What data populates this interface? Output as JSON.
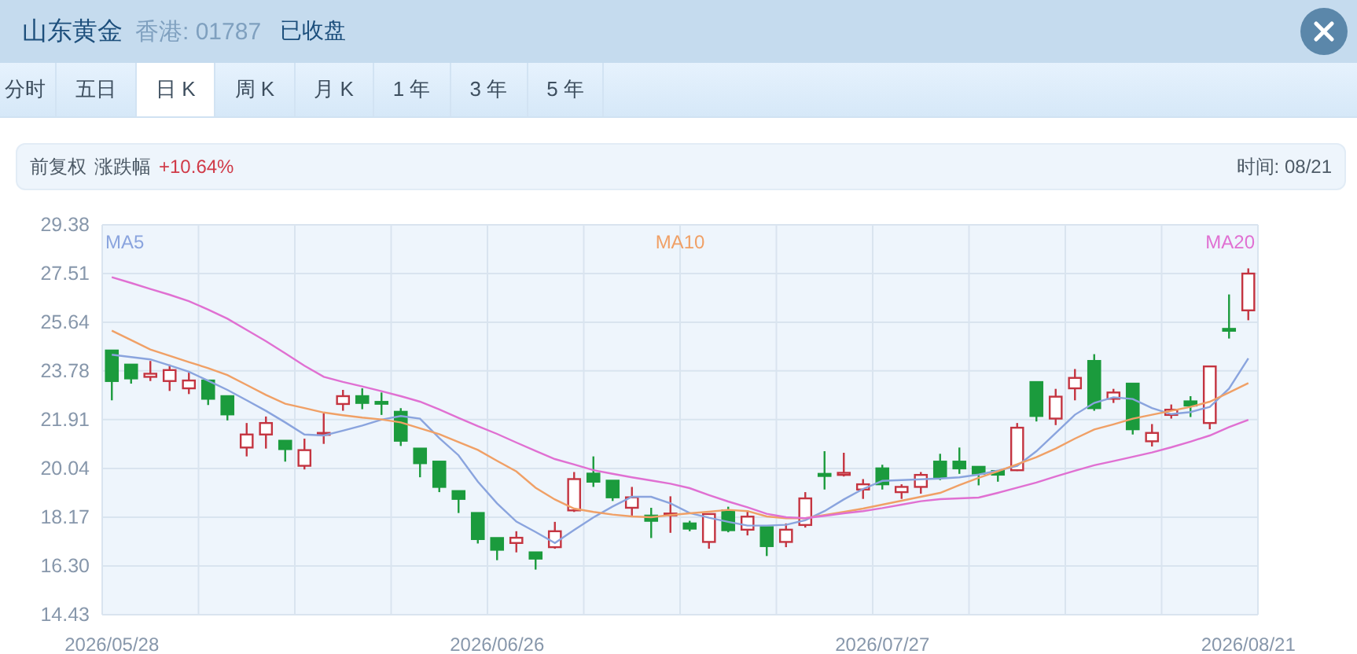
{
  "header": {
    "name": "山东黄金",
    "market": "香港: 01787",
    "status": "已收盘"
  },
  "tabs": [
    {
      "label": "分时",
      "selected": false
    },
    {
      "label": "五日",
      "selected": false
    },
    {
      "label": "日 K",
      "selected": true
    },
    {
      "label": "周 K",
      "selected": false
    },
    {
      "label": "月 K",
      "selected": false
    },
    {
      "label": "1 年",
      "selected": false
    },
    {
      "label": "3 年",
      "selected": false
    },
    {
      "label": "5 年",
      "selected": false
    }
  ],
  "info_bar": {
    "adjust": "前复权",
    "change_label": "涨跌幅",
    "change": "+10.64%",
    "time": "时间: 08/21"
  },
  "chart": {
    "chart_data": {
      "type": "candlestick",
      "grid": true,
      "categories": [
        "2026/05/28",
        null,
        null,
        null,
        null,
        null,
        null,
        null,
        null,
        null,
        null,
        null,
        null,
        null,
        null,
        null,
        null,
        null,
        null,
        null,
        "2026/06/26",
        null,
        null,
        null,
        null,
        null,
        null,
        null,
        null,
        null,
        null,
        null,
        null,
        null,
        null,
        null,
        null,
        null,
        null,
        null,
        "2026/07/27",
        null,
        null,
        null,
        null,
        null,
        null,
        null,
        null,
        null,
        null,
        null,
        null,
        null,
        null,
        null,
        null,
        null,
        null,
        "2026/08/21"
      ],
      "ylim": [
        14.43,
        29.38
      ],
      "yticks": [
        14.43,
        {
          "value": 16.3,
          "label": "16.30"
        },
        18.17,
        20.04,
        21.91,
        23.78,
        25.64,
        27.51,
        29.38
      ],
      "series": [
        {
          "name": "MA5",
          "type": "line",
          "color": "#8aa4de",
          "values": [
            24.4,
            24.31,
            24.22,
            23.99,
            23.75,
            23.4,
            23.05,
            22.65,
            22.25,
            21.8,
            21.34,
            21.3,
            21.49,
            21.68,
            21.91,
            22.05,
            21.95,
            21.2,
            20.54,
            19.53,
            18.7,
            18.0,
            17.6,
            17.18,
            17.68,
            18.16,
            18.58,
            18.95,
            18.95,
            18.7,
            18.33,
            18.15,
            17.99,
            17.85,
            17.85,
            17.88,
            18.05,
            18.4,
            18.85,
            19.25,
            19.56,
            19.59,
            19.62,
            19.65,
            19.7,
            19.8,
            19.95,
            20.14,
            20.7,
            21.4,
            22.1,
            22.55,
            22.77,
            22.7,
            22.35,
            22.12,
            22.2,
            22.4,
            23.1,
            24.26
          ]
        },
        {
          "name": "MA10",
          "type": "line",
          "color": "#f0a066",
          "values": [
            25.32,
            24.96,
            24.6,
            24.36,
            24.12,
            23.88,
            23.62,
            23.24,
            22.86,
            22.52,
            22.35,
            22.18,
            22.08,
            21.99,
            21.92,
            21.8,
            21.58,
            21.35,
            21.05,
            20.75,
            20.33,
            19.92,
            19.3,
            18.85,
            18.5,
            18.37,
            18.27,
            18.2,
            18.17,
            18.25,
            18.32,
            18.38,
            18.45,
            18.4,
            18.2,
            18.13,
            18.13,
            18.25,
            18.37,
            18.5,
            18.65,
            18.8,
            18.95,
            19.1,
            19.4,
            19.68,
            19.93,
            20.2,
            20.47,
            20.8,
            21.18,
            21.53,
            21.73,
            21.95,
            22.1,
            22.25,
            22.4,
            22.6,
            22.95,
            23.31
          ]
        },
        {
          "name": "MA20",
          "type": "line",
          "color": "#e070d2",
          "values": [
            27.37,
            27.15,
            26.92,
            26.7,
            26.45,
            26.13,
            25.78,
            25.35,
            24.92,
            24.45,
            23.98,
            23.55,
            23.36,
            23.18,
            23.0,
            22.81,
            22.6,
            22.3,
            21.98,
            21.66,
            21.36,
            21.03,
            20.71,
            20.4,
            20.19,
            19.97,
            19.83,
            19.7,
            19.58,
            19.45,
            19.28,
            19.02,
            18.77,
            18.55,
            18.3,
            18.17,
            18.13,
            18.22,
            18.32,
            18.4,
            18.52,
            18.65,
            18.78,
            18.86,
            18.89,
            18.92,
            19.1,
            19.3,
            19.5,
            19.73,
            19.95,
            20.16,
            20.32,
            20.48,
            20.65,
            20.85,
            21.07,
            21.3,
            21.62,
            21.9
          ]
        }
      ],
      "ohlc": [
        [
          24.56,
          24.56,
          22.65,
          23.39
        ],
        [
          24.02,
          24.02,
          23.29,
          23.49
        ],
        [
          23.55,
          24.16,
          23.39,
          23.67
        ],
        [
          23.39,
          24.02,
          23.01,
          23.81
        ],
        [
          23.11,
          23.71,
          22.89,
          23.41
        ],
        [
          23.41,
          23.41,
          22.47,
          22.71
        ],
        [
          22.81,
          22.81,
          21.88,
          22.11
        ],
        [
          20.84,
          21.78,
          20.5,
          21.34
        ],
        [
          21.34,
          22.03,
          20.8,
          21.78
        ],
        [
          21.1,
          21.1,
          20.3,
          20.78
        ],
        [
          20.14,
          21.18,
          20.0,
          20.74
        ],
        [
          21.34,
          22.15,
          20.98,
          21.4
        ],
        [
          22.51,
          23.05,
          22.25,
          22.81
        ],
        [
          22.81,
          23.11,
          22.31,
          22.55
        ],
        [
          22.59,
          22.95,
          22.09,
          22.53
        ],
        [
          22.21,
          22.35,
          20.9,
          21.1
        ],
        [
          20.8,
          20.8,
          19.7,
          20.24
        ],
        [
          20.3,
          20.3,
          19.13,
          19.33
        ],
        [
          19.17,
          19.17,
          18.33,
          18.87
        ],
        [
          18.33,
          18.33,
          17.16,
          17.33
        ],
        [
          17.37,
          17.37,
          16.52,
          16.92
        ],
        [
          17.18,
          17.63,
          16.82,
          17.38
        ],
        [
          16.82,
          16.82,
          16.16,
          16.58
        ],
        [
          17.02,
          17.99,
          16.96,
          17.63
        ],
        [
          18.43,
          19.9,
          18.37,
          19.63
        ],
        [
          19.84,
          20.5,
          19.33,
          19.53
        ],
        [
          19.57,
          19.57,
          18.79,
          18.93
        ],
        [
          18.53,
          19.33,
          18.23,
          18.93
        ],
        [
          18.23,
          18.53,
          17.37,
          18.03
        ],
        [
          18.27,
          18.97,
          17.57,
          18.31
        ],
        [
          17.93,
          18.03,
          17.63,
          17.73
        ],
        [
          17.22,
          18.29,
          16.96,
          18.29
        ],
        [
          18.43,
          18.57,
          17.59,
          17.67
        ],
        [
          17.69,
          18.43,
          17.47,
          18.19
        ],
        [
          17.79,
          17.79,
          16.68,
          17.06
        ],
        [
          17.22,
          17.93,
          17.02,
          17.69
        ],
        [
          17.87,
          19.13,
          17.77,
          18.89
        ],
        [
          19.83,
          20.7,
          19.23,
          19.75
        ],
        [
          19.79,
          20.64,
          19.73,
          19.87
        ],
        [
          19.23,
          19.63,
          18.87,
          19.43
        ],
        [
          20.04,
          20.18,
          19.23,
          19.43
        ],
        [
          19.13,
          19.43,
          18.87,
          19.33
        ],
        [
          19.33,
          19.9,
          19.07,
          19.79
        ],
        [
          20.3,
          20.6,
          19.59,
          19.7
        ],
        [
          20.3,
          20.84,
          19.83,
          20.04
        ],
        [
          20.1,
          20.1,
          19.39,
          19.84
        ],
        [
          19.94,
          19.94,
          19.53,
          19.8
        ],
        [
          19.97,
          21.78,
          19.94,
          21.6
        ],
        [
          23.35,
          23.35,
          21.84,
          22.05
        ],
        [
          21.95,
          23.09,
          21.7,
          22.79
        ],
        [
          23.11,
          23.85,
          22.65,
          23.51
        ],
        [
          24.16,
          24.42,
          22.25,
          22.35
        ],
        [
          22.71,
          23.09,
          22.55,
          22.95
        ],
        [
          23.29,
          23.29,
          21.34,
          21.54
        ],
        [
          21.08,
          21.74,
          20.88,
          21.4
        ],
        [
          22.09,
          22.49,
          21.95,
          22.29
        ],
        [
          22.61,
          22.81,
          22.01,
          22.45
        ],
        [
          21.78,
          23.95,
          21.54,
          23.95
        ],
        [
          25.39,
          26.71,
          25.02,
          25.33
        ],
        [
          26.1,
          27.71,
          25.72,
          27.51
        ]
      ]
    }
  }
}
